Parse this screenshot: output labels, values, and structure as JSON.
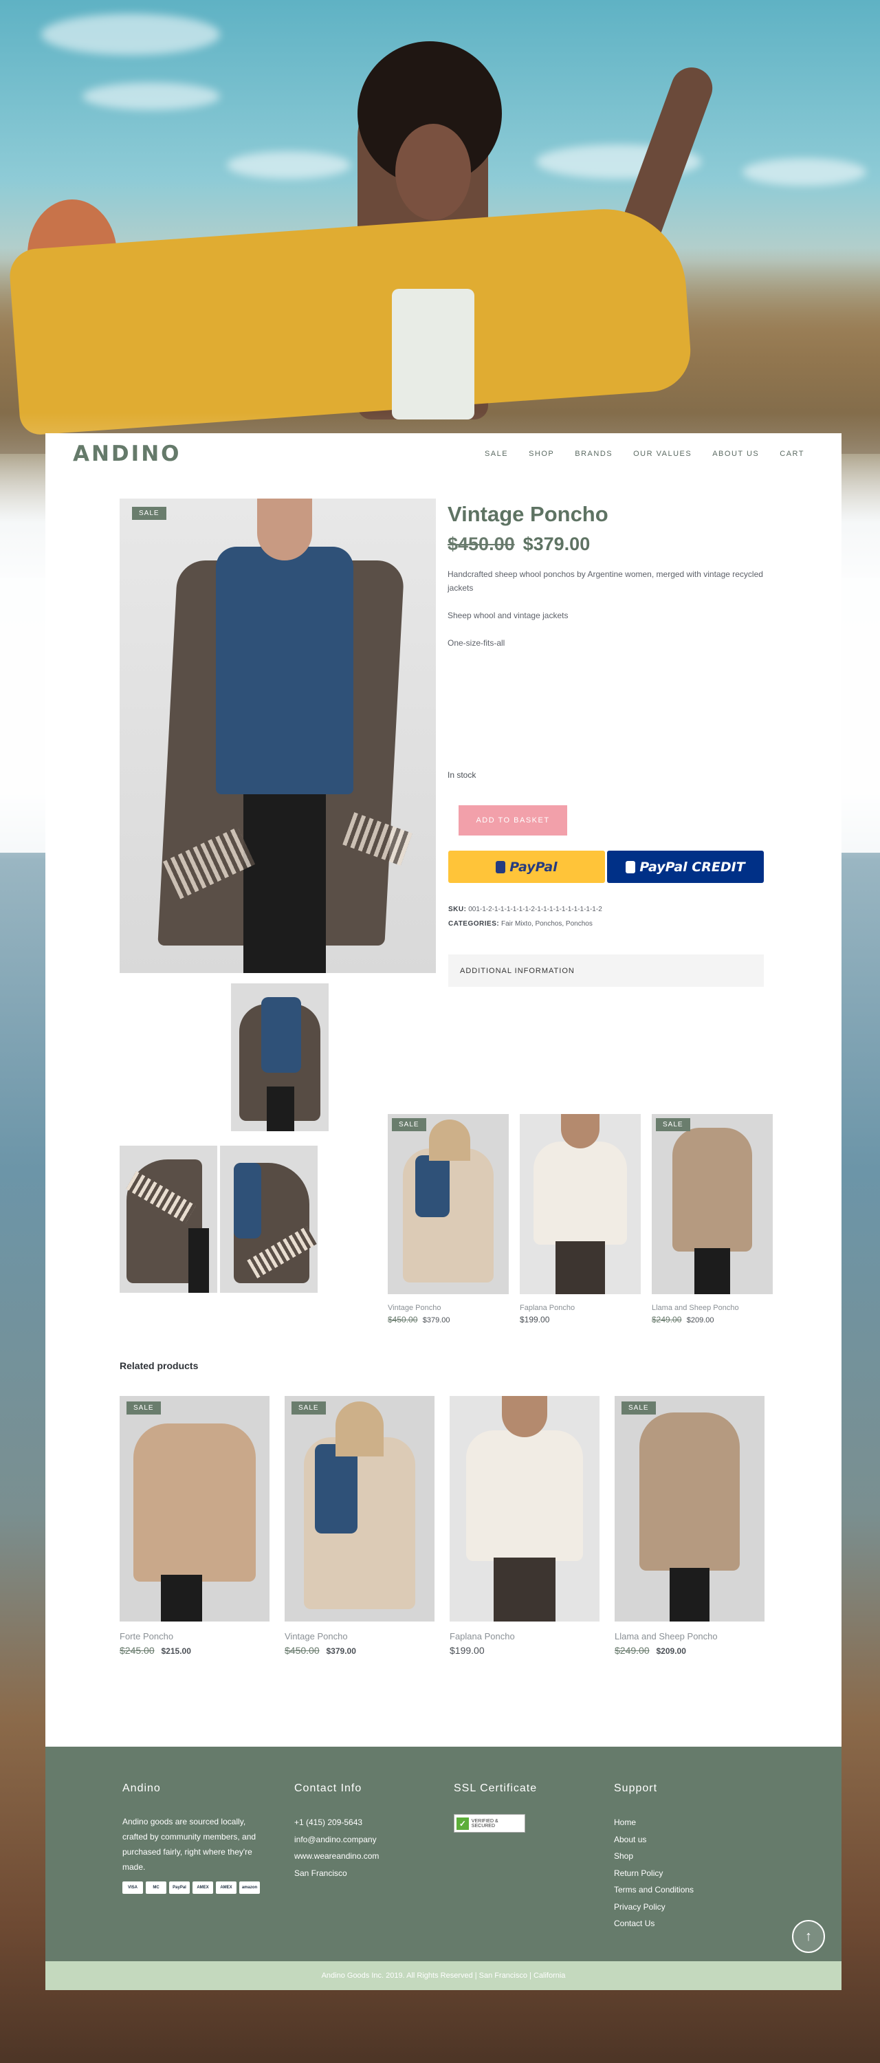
{
  "brand": {
    "logo": "ANDINO"
  },
  "nav": {
    "items": [
      "SALE",
      "SHOP",
      "BRANDS",
      "OUR VALUES",
      "ABOUT US",
      "CART"
    ]
  },
  "product": {
    "badge": "SALE",
    "title": "Vintage Poncho",
    "old_price": "$450.00",
    "new_price": "$379.00",
    "description": [
      "Handcrafted sheep whool ponchos by Argentine women, merged with vintage recycled jackets",
      "Sheep whool and vintage jackets",
      "One-size-fits-all"
    ],
    "stock": "In stock",
    "add_to_basket": "ADD TO BASKET",
    "paypal_label": "PayPal",
    "paypal_credit_label": "PayPal CREDIT",
    "sku_label": "SKU:",
    "sku_value": "001-1-2-1-1-1-1-1-1-2-1-1-1-1-1-1-1-1-1-1-2",
    "categories_label": "CATEGORIES:",
    "categories_value": "Fair Mixto,  Ponchos,  Ponchos",
    "additional_info": "ADDITIONAL INFORMATION"
  },
  "mini_products": [
    {
      "badge": "SALE",
      "name": "Vintage Poncho",
      "old_price": "$450.00",
      "price": "$379.00"
    },
    {
      "badge": "",
      "name": "Faplana Poncho",
      "old_price": "",
      "price": "$199.00"
    },
    {
      "badge": "SALE",
      "name": "Llama and Sheep Poncho",
      "old_price": "$249.00",
      "price": "$209.00"
    }
  ],
  "related": {
    "title": "Related products",
    "items": [
      {
        "badge": "SALE",
        "name": "Forte Poncho",
        "old_price": "$245.00",
        "price": "$215.00"
      },
      {
        "badge": "SALE",
        "name": "Vintage Poncho",
        "old_price": "$450.00",
        "price": "$379.00"
      },
      {
        "badge": "",
        "name": "Faplana Poncho",
        "old_price": "",
        "price": "$199.00"
      },
      {
        "badge": "SALE",
        "name": "Llama and Sheep Poncho",
        "old_price": "$249.00",
        "price": "$209.00"
      }
    ]
  },
  "footer": {
    "andino_title": "Andino",
    "andino_text": "Andino goods are sourced locally, crafted by community members, and purchased fairly, right where they're made.",
    "payment_cards": [
      "VISA",
      "MC",
      "PayPal",
      "AMEX",
      "AMEX",
      "amazon"
    ],
    "contact_title": "Contact Info",
    "contact": [
      "+1 (415) 209-5643",
      "info@andino.company",
      "www.weareandino.com",
      "San Francisco"
    ],
    "ssl_title": "SSL Certificate",
    "ssl_badge": "VERIFIED & SECURED",
    "support_title": "Support",
    "support_links": [
      "Home",
      "About us",
      "Shop",
      "Return Policy",
      "Terms and Conditions",
      "Privacy Policy",
      "Contact Us"
    ],
    "copyright": "Andino Goods Inc. 2019. All Rights Reserved | San Francisco | California"
  },
  "colors": {
    "accent": "#667b6b",
    "sale_badge": "#6a7d6d",
    "basket_button": "#f2a0aa",
    "paypal_gold": "#ffc439",
    "paypal_blue": "#003087"
  }
}
